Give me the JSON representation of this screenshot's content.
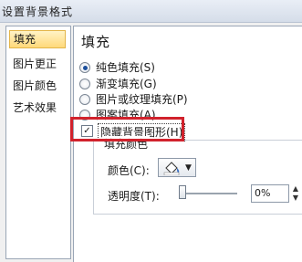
{
  "window": {
    "title": "设置背景格式"
  },
  "sidebar": {
    "items": [
      {
        "label": "填充",
        "selected": true
      },
      {
        "label": "图片更正",
        "selected": false
      },
      {
        "label": "图片颜色",
        "selected": false
      },
      {
        "label": "艺术效果",
        "selected": false
      }
    ]
  },
  "fill": {
    "title": "填充",
    "options": [
      {
        "label": "纯色填充(S)",
        "checked": true
      },
      {
        "label": "渐变填充(G)",
        "checked": false
      },
      {
        "label": "图片或纹理填充(P)",
        "checked": false
      },
      {
        "label": "图案填充(A)",
        "checked": false
      }
    ],
    "hide_background": {
      "label": "隐藏背景图形(H)",
      "checked": true
    },
    "group_title": "填充颜色",
    "color_label": "颜色(C):",
    "transparency_label": "透明度(T):",
    "transparency_value": "0%",
    "accent_highlight": "#d1222c"
  }
}
